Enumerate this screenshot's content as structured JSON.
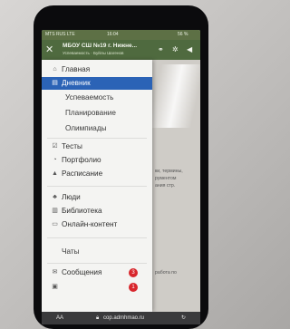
{
  "status_bar": {
    "carrier": "MTS RUS  LTE",
    "time": "16:04",
    "battery": "56 %"
  },
  "app_bar": {
    "close_icon": "close-icon",
    "title": "МБОУ СШ №19 г. Нижне...",
    "subtitle": "Успеваемость · Буйлы Шагенов"
  },
  "menu": {
    "items": [
      {
        "label": "Главная",
        "icon": "home-icon"
      },
      {
        "label": "Дневник",
        "icon": "book-icon",
        "active": true
      },
      {
        "label": "Успеваемость"
      },
      {
        "label": "Планирование"
      },
      {
        "label": "Олимпиады"
      },
      {
        "label": "Тесты",
        "icon": "checkbox-icon"
      },
      {
        "label": "Портфолио",
        "icon": "portfolio-icon"
      },
      {
        "label": "Расписание",
        "icon": "bell-icon"
      },
      {
        "label": "Люди",
        "icon": "people-icon"
      },
      {
        "label": "Библиотека",
        "icon": "library-icon"
      },
      {
        "label": "Онлайн-контент",
        "icon": "media-icon"
      },
      {
        "label": "Чаты"
      },
      {
        "label": "Сообщения",
        "icon": "mail-icon",
        "badge": "3"
      },
      {
        "label": "",
        "badge": "1"
      }
    ]
  },
  "background": {
    "lines": [
      "ки, термины,",
      "рументом",
      "ания стр.",
      "работа по"
    ]
  },
  "browser": {
    "aa": "AA",
    "url": "cop.admhmao.ru",
    "reload": "↻"
  }
}
